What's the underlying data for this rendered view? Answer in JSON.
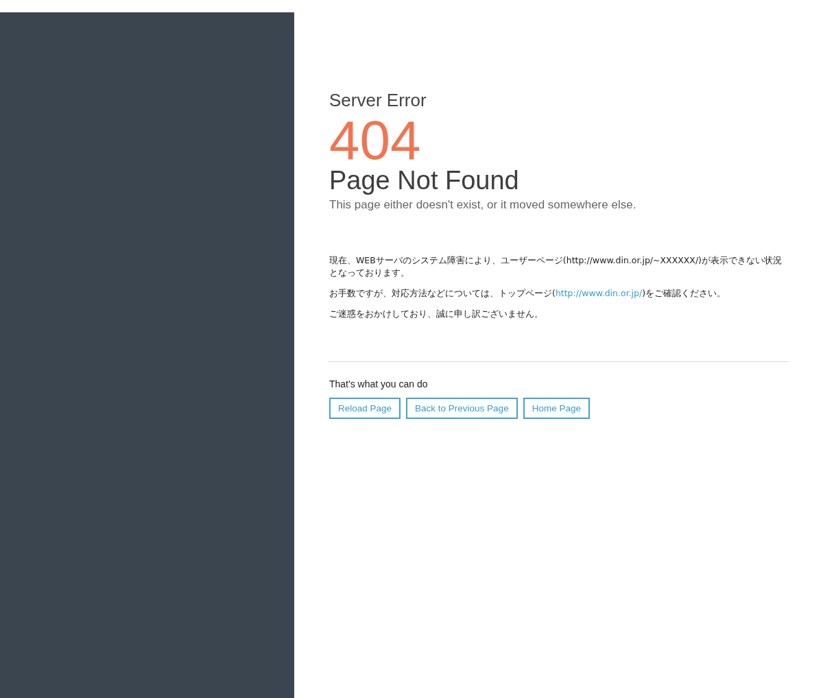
{
  "header": {
    "eyebrow": "Server Error",
    "code": "404",
    "title": "Page Not Found",
    "subtitle": "This page either doesn't exist, or it moved somewhere else."
  },
  "notice": [
    {
      "text": "現在、WEBサーバのシステム障害により、ユーザーページ(http://www.din.or.jp/~XXXXXX/)が表示できない状況となっております。"
    },
    {
      "text": "お手数ですが、対応方法などについては、トップページ(",
      "link": "http://www.din.or.jp/",
      "after": ")をご確認ください。"
    },
    {
      "text": "ご迷惑をおかけしており、誠に申し訳ございません。"
    }
  ],
  "actions": {
    "heading": "That's what you can do",
    "buttons": [
      "Reload Page",
      "Back to Previous Page",
      "Home Page"
    ]
  }
}
